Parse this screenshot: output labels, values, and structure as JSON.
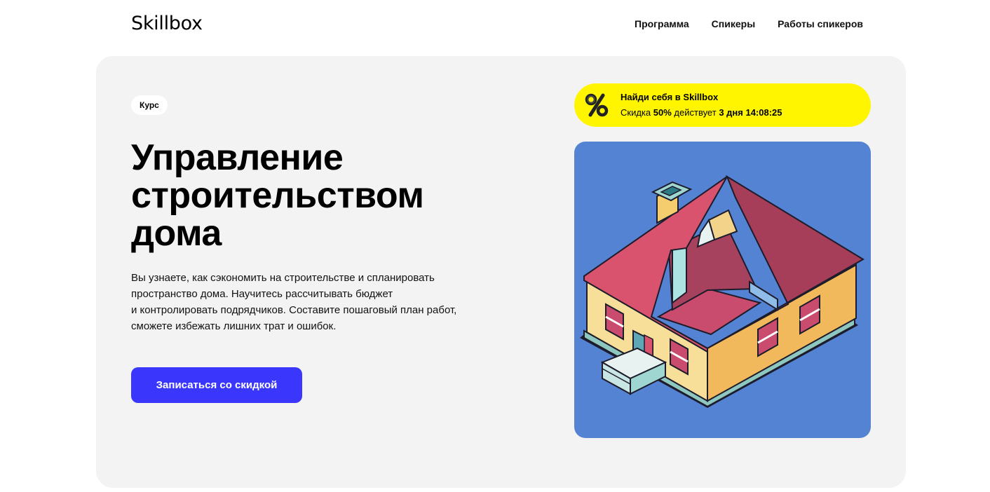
{
  "header": {
    "logo": "Skillbox",
    "nav": [
      {
        "label": "Программа"
      },
      {
        "label": "Спикеры"
      },
      {
        "label": "Работы спикеров"
      }
    ]
  },
  "hero": {
    "badge": "Курс",
    "title_lines": [
      "Управление",
      "строительством",
      "дома"
    ],
    "description_lines": [
      "Вы узнаете, как сэкономить на строительстве и спланировать",
      "пространство дома. Научитесь рассчитывать бюджет",
      "и контролировать подрядчиков. Составите пошаговый план работ,",
      "сможете избежать лишних трат и ошибок."
    ],
    "cta_label": "Записаться со скидкой"
  },
  "promo": {
    "icon": "percent-icon",
    "title": "Найди себя в Skillbox",
    "text_prefix": "Скидка",
    "discount": "50%",
    "text_middle": "действует",
    "duration": "3 дня",
    "timer": "14:08:25",
    "background_color": "#fff501"
  },
  "illustration": {
    "icon": "house-illustration",
    "background_color": "#5583d4"
  },
  "colors": {
    "accent": "#3b36fb",
    "hero_background": "#f3f3f4"
  }
}
